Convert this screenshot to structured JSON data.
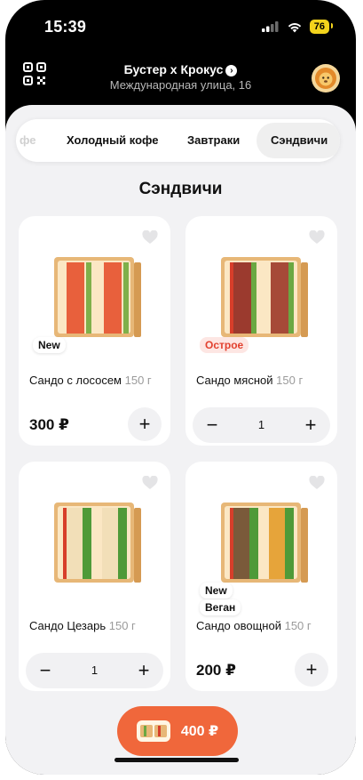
{
  "status_bar": {
    "time": "15:39",
    "battery": "76"
  },
  "header": {
    "title": "Бустер х Крокус",
    "subtitle": "Международная улица, 16"
  },
  "tabs": [
    {
      "label": "фе",
      "state": "faded"
    },
    {
      "label": "Холодный кофе",
      "state": "normal"
    },
    {
      "label": "Завтраки",
      "state": "normal"
    },
    {
      "label": "Сэндвичи",
      "state": "active"
    }
  ],
  "section_title": "Сэндвичи",
  "products": [
    {
      "name": "Сандо с лососем",
      "weight": "150 г",
      "badges": [
        "New"
      ],
      "price": "300 ₽",
      "qty": null,
      "filling": "salmon"
    },
    {
      "name": "Сандо мясной",
      "weight": "150 г",
      "badges": [
        "Острое"
      ],
      "price": null,
      "qty": "1",
      "filling": "meat"
    },
    {
      "name": "Сандо Цезарь",
      "weight": "150 г",
      "badges": [],
      "price": null,
      "qty": "1",
      "filling": "caesar"
    },
    {
      "name": "Сандо овощной",
      "weight": "150 г",
      "badges": [
        "New",
        "Веган"
      ],
      "price": "200 ₽",
      "qty": null,
      "filling": "veggie"
    }
  ],
  "cart": {
    "total": "400 ₽"
  },
  "colors": {
    "accent": "#f0673b",
    "spicy": "#e2412f",
    "battery": "#f3d31c"
  }
}
